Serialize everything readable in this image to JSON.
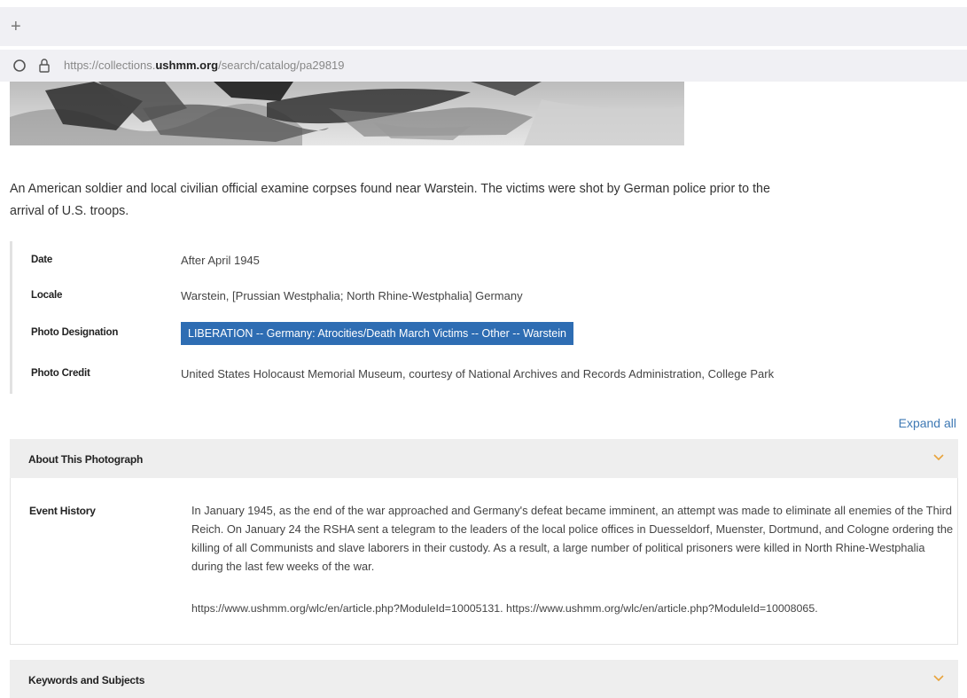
{
  "browser": {
    "new_tab_label": "+",
    "url_prefix": "https://collections.",
    "url_domain": "ushmm.org",
    "url_path": "/search/catalog/pa29819"
  },
  "caption": "An American soldier and local civilian official examine corpses found near Warstein. The victims were shot by German police prior to the arrival of U.S. troops.",
  "metadata": [
    {
      "key": "Date",
      "value": "After April 1945"
    },
    {
      "key": "Locale",
      "value": "Warstein, [Prussian Westphalia; North Rhine-Westphalia] Germany"
    },
    {
      "key": "Photo Designation",
      "value": "LIBERATION -- Germany: Atrocities/Death March Victims -- Other -- Warstein"
    },
    {
      "key": "Photo Credit",
      "value": "United States Holocaust Memorial Museum, courtesy of National Archives and Records Administration, College Park"
    }
  ],
  "expand_all": "Expand all",
  "sections": [
    {
      "title": "About This Photograph",
      "fields": [
        {
          "key": "Event History",
          "value": "In January 1945, as the end of the war approached and Germany's defeat became imminent, an attempt was made to eliminate all enemies of the Third Reich. On January 24 the RSHA sent a telegram to the leaders of the local police offices in Duesseldorf, Muenster, Dortmund, and Cologne ordering the killing of all Communists and slave laborers in their custody. As a result, a large number of political prisoners were killed in North Rhine-Westphalia during the last few weeks of the war.",
          "links": "https://www.ushmm.org/wlc/en/article.php?ModuleId=10005131. https://www.ushmm.org/wlc/en/article.php?ModuleId=10008065."
        }
      ]
    },
    {
      "title": "Keywords and Subjects"
    }
  ],
  "colors": {
    "accent": "#2e6db3",
    "link": "#3e79b4",
    "chevron": "#e8a33c",
    "panel": "#eeeeee"
  }
}
